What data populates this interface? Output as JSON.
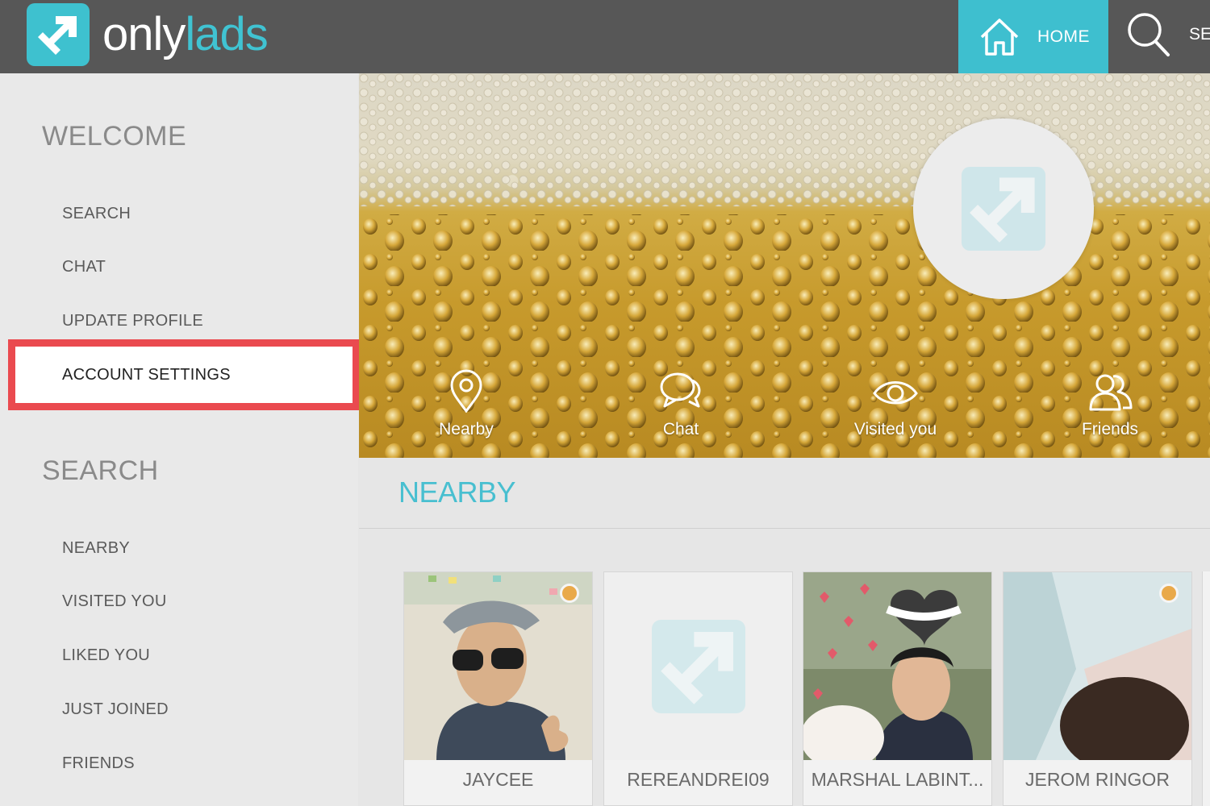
{
  "header": {
    "logo_only": "only",
    "logo_lads": "lads",
    "home_label": "HOME",
    "search_label": "SEA",
    "icons": {
      "logo": "arrow-logo-icon",
      "home": "home-icon",
      "search": "search-icon"
    },
    "colors": {
      "bar": "#575757",
      "accent": "#3ebfcf"
    }
  },
  "sidebar": {
    "welcome_title": "WELCOME",
    "welcome_items": [
      {
        "label": "SEARCH"
      },
      {
        "label": "CHAT"
      },
      {
        "label": "UPDATE PROFILE"
      },
      {
        "label": "ACCOUNT SETTINGS",
        "highlighted": true
      }
    ],
    "search_title": "SEARCH",
    "search_items": [
      {
        "label": "NEARBY"
      },
      {
        "label": "VISITED YOU"
      },
      {
        "label": "LIKED YOU"
      },
      {
        "label": "JUST JOINED"
      },
      {
        "label": "FRIENDS"
      }
    ],
    "highlight_color": "#ea4a4f"
  },
  "hero": {
    "links": [
      {
        "label": "Nearby",
        "icon": "location-pin-icon"
      },
      {
        "label": "Chat",
        "icon": "chat-bubbles-icon"
      },
      {
        "label": "Visited you",
        "icon": "eye-icon"
      },
      {
        "label": "Friends",
        "icon": "friends-icon"
      }
    ]
  },
  "main": {
    "section_title": "NEARBY",
    "cards": [
      {
        "name": "JAYCEE",
        "online": true
      },
      {
        "name": "REREANDREI09",
        "online": false
      },
      {
        "name": "MARSHAL LABINT...",
        "online": false
      },
      {
        "name": "JEROM RINGOR",
        "online": true
      }
    ],
    "online_color": "#e9a94a"
  }
}
